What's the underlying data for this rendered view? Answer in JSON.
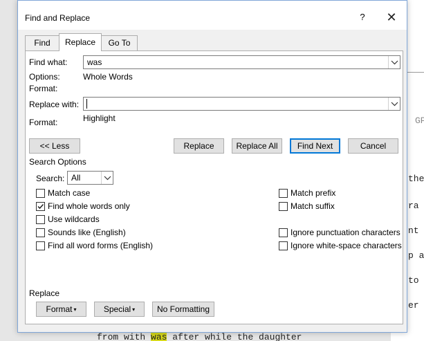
{
  "dialog": {
    "title": "Find and Replace",
    "help_label": "?",
    "close_label": "✕"
  },
  "tabs": [
    {
      "label": "Find",
      "active": false
    },
    {
      "label": "Replace",
      "active": true
    },
    {
      "label": "Go To",
      "active": false
    }
  ],
  "find": {
    "label": "Find what:",
    "value": "was",
    "options_label": "Options:",
    "options_value": "Whole Words",
    "format_label": "Format:"
  },
  "replace": {
    "label": "Replace with:",
    "value": "",
    "format_label": "Format:",
    "format_value": "Highlight"
  },
  "buttons": {
    "less": "<< Less",
    "replace": "Replace",
    "replace_all": "Replace All",
    "find_next": "Find Next",
    "cancel": "Cancel"
  },
  "search_options": {
    "heading": "Search Options",
    "search_label": "Search:",
    "search_value": "All",
    "left_checkboxes": [
      {
        "label": "Match case",
        "checked": false
      },
      {
        "label": "Find whole words only",
        "checked": true
      },
      {
        "label": "Use wildcards",
        "checked": false
      },
      {
        "label": "Sounds like (English)",
        "checked": false
      },
      {
        "label": "Find all word forms (English)",
        "checked": false
      }
    ],
    "right_checkboxes": [
      {
        "label": "Match prefix",
        "checked": false
      },
      {
        "label": "Match suffix",
        "checked": false
      },
      {
        "label": "Ignore punctuation characters",
        "checked": false
      },
      {
        "label": "Ignore white-space characters",
        "checked": false
      }
    ]
  },
  "replace_section": {
    "heading": "Replace",
    "format_button": "Format",
    "special_button": "Special",
    "no_formatting_button": "No Formatting"
  },
  "background_doc": {
    "fragments": [
      "GP",
      "the",
      "ra",
      "nt",
      "p a",
      "to",
      "er"
    ],
    "bottom_line_before": "from with  ",
    "bottom_line_highlight": "was",
    "bottom_line_after": "  after while the daughter"
  },
  "colors": {
    "accent": "#0078d7",
    "highlight": "#d6d81a",
    "window_border": "#7fa6d8"
  }
}
